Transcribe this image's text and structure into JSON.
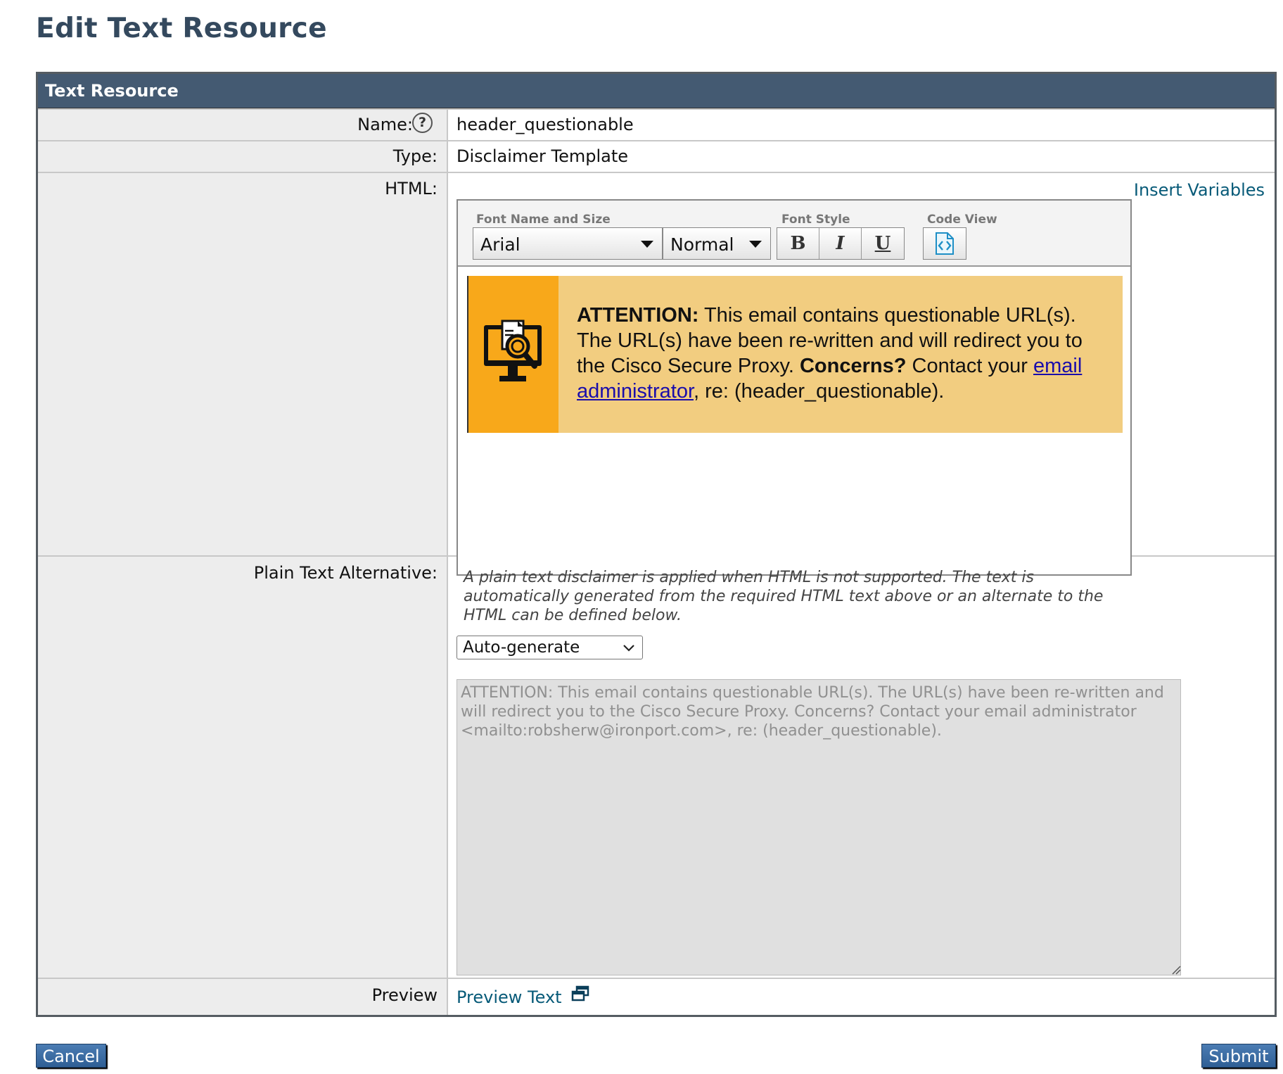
{
  "page": {
    "title": "Edit Text Resource"
  },
  "panel": {
    "header": "Text Resource"
  },
  "name_row": {
    "label": "Name:",
    "value": "header_questionable",
    "help": "?"
  },
  "type_row": {
    "label": "Type:",
    "value": "Disclaimer Template"
  },
  "html_row": {
    "label": "HTML:",
    "insert_variables": "Insert Variables",
    "toolbar": {
      "font_group_label": "Font Name and Size",
      "font_name": "Arial",
      "font_size": "Normal",
      "style_group_label": "Font Style",
      "bold": "B",
      "italic": "I",
      "underline": "U",
      "code_group_label": "Code View"
    },
    "banner": {
      "strong1": "ATTENTION:",
      "text1": " This email contains questionable URL(s). The URL(s) have been re-written and will redirect you to the Cisco Secure Proxy. ",
      "strong2": "Concerns?",
      "text2": " Contact your ",
      "link": "email administrator",
      "text3": ", re: (header_questionable).",
      "icon": "computer-inspection-icon",
      "icon_bg": "#f8a81a",
      "bg": "#f2cd80"
    }
  },
  "plain_row": {
    "label": "Plain Text Alternative:",
    "hint": "A plain text disclaimer is applied when HTML is not supported. The text is automatically generated from the required HTML text above or an alternate to the HTML can be defined below.",
    "select_value": "Auto-generate",
    "text": "ATTENTION: This email contains questionable URL(s). The URL(s) have been re-written and will redirect you to the Cisco Secure Proxy. Concerns? Contact your email administrator <mailto:robsherw@ironport.com>, re: (header_questionable)."
  },
  "preview_row": {
    "label": "Preview",
    "link": "Preview Text",
    "icon": "popup-window-icon"
  },
  "buttons": {
    "cancel": "Cancel",
    "submit": "Submit"
  },
  "colors": {
    "title": "#34495e",
    "header_bg": "#445a72",
    "link": "#075a78",
    "button": "#2f5f95"
  }
}
